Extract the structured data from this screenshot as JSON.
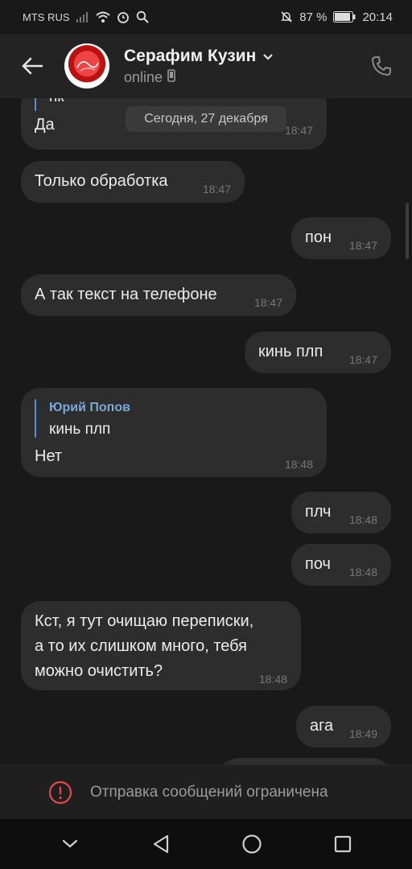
{
  "status_bar": {
    "carrier": "MTS RUS",
    "battery_percent": "87 %",
    "clock": "20:14",
    "icons": [
      "signal-icon",
      "wifi-icon",
      "alarm-icon",
      "search-icon",
      "mute-icon",
      "battery-icon"
    ]
  },
  "header": {
    "contact_name": "Серафим Кузин",
    "status": "online",
    "icons": [
      "back-arrow-icon",
      "chevron-down-icon",
      "phone-icon",
      "mobile-device-icon"
    ]
  },
  "chat": {
    "date_badge": "Сегодня, 27 декабря",
    "messages": [
      {
        "side": "in",
        "reply_text": "пк",
        "text": "Да",
        "time": "18:47"
      },
      {
        "side": "in",
        "text": "Только обработка",
        "time": "18:47"
      },
      {
        "side": "out",
        "text": "пон",
        "time": "18:47"
      },
      {
        "side": "in",
        "text": "А так текст на телефоне",
        "time": "18:47"
      },
      {
        "side": "out",
        "text": "кинь плп",
        "time": "18:47"
      },
      {
        "side": "in",
        "reply_author": "Юрий Попов",
        "reply_text": "кинь плп",
        "text": "Нет",
        "time": "18:48"
      },
      {
        "side": "out",
        "text": "плч",
        "time": "18:48"
      },
      {
        "side": "out",
        "text": "поч",
        "time": "18:48"
      },
      {
        "side": "in",
        "lines": [
          "Кст, я тут очищаю переписки,",
          "а то их слишком много, тебя",
          "можно очистить?"
        ],
        "time": "18:48"
      },
      {
        "side": "out",
        "text": "ага",
        "time": "18:49"
      }
    ]
  },
  "restriction": {
    "text": "Отправка сообщений ограничена",
    "icon": "warning-icon",
    "accent": "#e0484b"
  },
  "nav": {
    "icons": [
      "collapse-icon",
      "back-triangle-icon",
      "home-circle-icon",
      "recents-square-icon"
    ]
  }
}
